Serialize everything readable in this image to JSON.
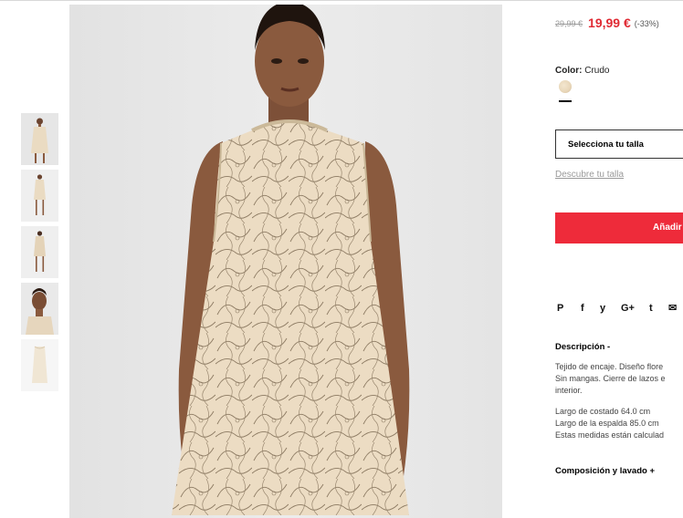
{
  "product": {
    "price_old": "29,99 €",
    "price_new": "19,99 €",
    "discount": "(-33%)",
    "color_label": "Color:",
    "color_value": "Crudo",
    "size_select": "Selecciona tu talla",
    "size_link": "Descubre tu talla",
    "add_button": "Añadir"
  },
  "share_icons": [
    {
      "name": "pinterest-icon",
      "glyph": "P"
    },
    {
      "name": "facebook-icon",
      "glyph": "f"
    },
    {
      "name": "twitter-icon",
      "glyph": "y"
    },
    {
      "name": "googleplus-icon",
      "glyph": "G+"
    },
    {
      "name": "tumblr-icon",
      "glyph": "t"
    },
    {
      "name": "mail-icon",
      "glyph": "✉"
    }
  ],
  "description": {
    "title": "Descripción -",
    "para1_line1": "Tejido de encaje. Diseño flore",
    "para1_line2": "Sin mangas. Cierre de lazos e",
    "para1_line3": "interior.",
    "para2_line1": "Largo de costado 64.0 cm",
    "para2_line2": "Largo de la espalda 85.0 cm",
    "para2_line3": "Estas medidas están calculad"
  },
  "composition": {
    "title": "Composición y lavado +"
  },
  "colors": {
    "sale_red": "#e02a33",
    "button_red": "#ee2b3a",
    "dress": "#ecdcc3",
    "skin": "#8a5a3e"
  }
}
